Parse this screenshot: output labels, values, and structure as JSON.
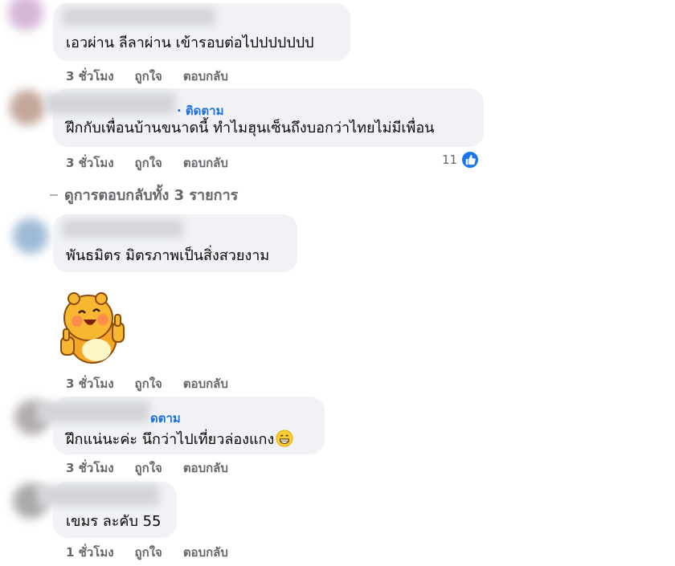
{
  "actions": {
    "like_label": "ถูกใจ",
    "reply_label": "ตอบกลับ"
  },
  "comments": [
    {
      "text": "เอวผ่าน ลีลาผ่าน เข้ารอบต่อไปปปปปปป",
      "time": "3 ชั่วโมง"
    },
    {
      "follow_label": "· ติดตาม",
      "text": "ฝึกกับเพื่อนบ้านขนาดนี้ ทำไมฮุนเซ็นถึงบอกว่าไทยไม่มีเพื่อน",
      "time": "3 ชั่วโมง",
      "reaction_count": "11",
      "reaction_icon": "like-icon"
    }
  ],
  "view_replies": "ดูการตอบกลับทั้ง 3 รายการ",
  "replies": [
    {
      "text": "พันธมิตร มิตรภาพเป็นสิ่งสวยงาม",
      "sticker": "thumbs-up-bear-sticker",
      "time": "3 ชั่วโมง"
    },
    {
      "follow_label": "ดตาม",
      "text": "ฝึกแน่นะค่ะ นึกว่าไปเที่ยวล่องแกง",
      "emoji": "grinning-face-icon",
      "time": "3 ชั่วโมง"
    },
    {
      "text": "เขมร ละคับ 55",
      "time": "1 ชั่วโมง"
    }
  ],
  "colors": {
    "bubble": "#f0f2f5",
    "link_blue": "#216fdb",
    "meta_gray": "#65676b",
    "like_blue": "#1877f2"
  }
}
